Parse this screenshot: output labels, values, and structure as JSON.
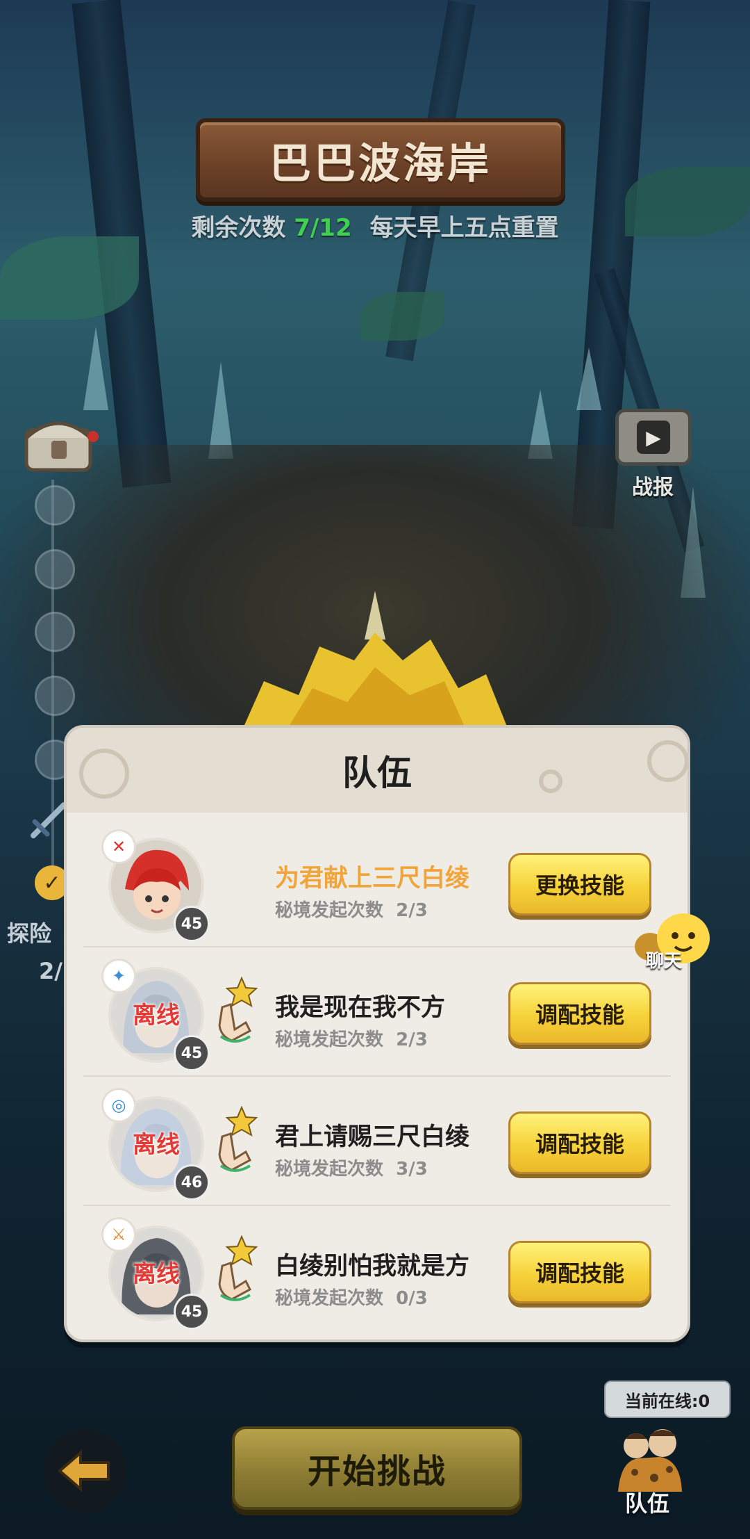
{
  "header": {
    "title": "巴巴波海岸",
    "remaining_label": "剩余次数",
    "remaining_count": "7/12",
    "reset_note": "每天早上五点重置"
  },
  "side": {
    "explore_label": "探险",
    "explore_progress": "2/"
  },
  "battle_report": {
    "label": "战报"
  },
  "team_panel": {
    "title": "队伍",
    "members": [
      {
        "name": "为君献上三尺白绫",
        "count_label": "秘境发起次数",
        "count": "2/3",
        "level": "45",
        "status": "",
        "button": "更换技能",
        "is_self": true
      },
      {
        "name": "我是现在我不方",
        "count_label": "秘境发起次数",
        "count": "2/3",
        "level": "45",
        "status": "离线",
        "button": "调配技能",
        "is_self": false
      },
      {
        "name": "君上请赐三尺白绫",
        "count_label": "秘境发起次数",
        "count": "3/3",
        "level": "46",
        "status": "离线",
        "button": "调配技能",
        "is_self": false
      },
      {
        "name": "白绫别怕我就是方",
        "count_label": "秘境发起次数",
        "count": "0/3",
        "level": "45",
        "status": "离线",
        "button": "调配技能",
        "is_self": false
      }
    ]
  },
  "chat": {
    "label": "聊天"
  },
  "bottom": {
    "start_button": "开始挑战",
    "online_status": "当前在线:0",
    "team_label": "队伍"
  },
  "colors": {
    "count_highlight": "#3fd04f",
    "self_name": "#f0a43a",
    "offline": "#e53935",
    "button_yellow": "#f6d23a"
  },
  "icons": [
    "back-arrow-icon",
    "video-icon",
    "chest-icon",
    "sword-icon",
    "check-icon",
    "chat-face-icon",
    "hand-star-icon",
    "team-avatar-icon"
  ]
}
